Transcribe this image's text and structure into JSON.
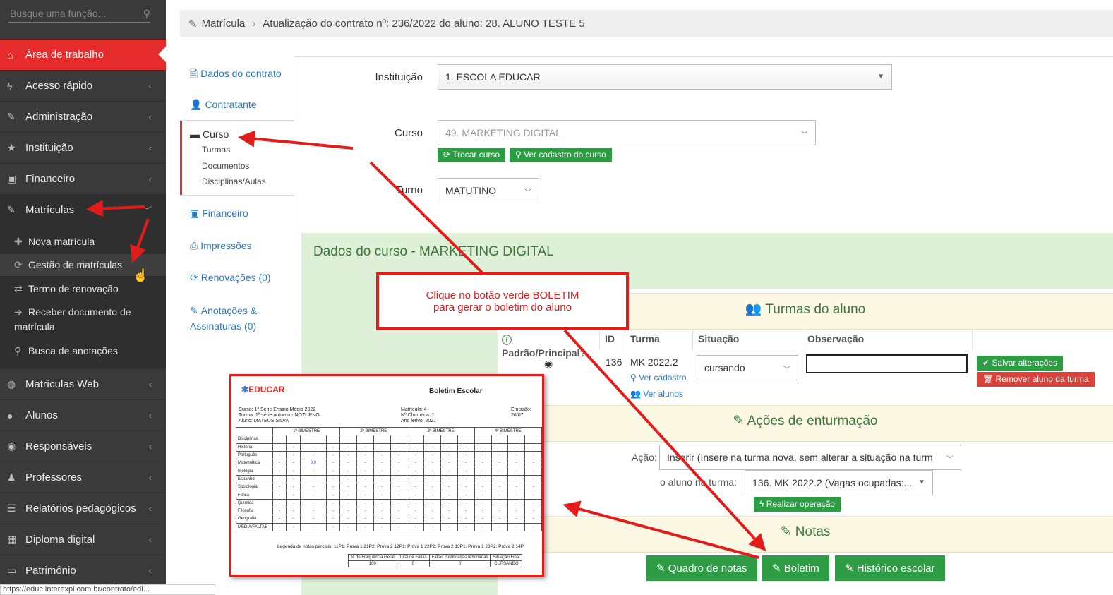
{
  "sidebar": {
    "search_placeholder": "Busque uma função...",
    "items": [
      {
        "label": "Área de trabalho",
        "icon": "home-icon"
      },
      {
        "label": "Acesso rápido",
        "icon": "bolt-icon"
      },
      {
        "label": "Administração",
        "icon": "wrench-icon"
      },
      {
        "label": "Instituição",
        "icon": "star-icon"
      },
      {
        "label": "Financeiro",
        "icon": "money-icon"
      },
      {
        "label": "Matrículas",
        "icon": "edit-icon"
      },
      {
        "label": "Matrículas Web",
        "icon": "globe-icon"
      },
      {
        "label": "Alunos",
        "icon": "user-icon"
      },
      {
        "label": "Responsáveis",
        "icon": "eye-icon"
      },
      {
        "label": "Professores",
        "icon": "teacher-icon"
      },
      {
        "label": "Relatórios pedagógicos",
        "icon": "list-icon"
      },
      {
        "label": "Diploma digital",
        "icon": "qrcode-icon"
      },
      {
        "label": "Patrimônio",
        "icon": "drive-icon"
      }
    ],
    "submenu": [
      {
        "label": "Nova matrícula",
        "icon": "plus-icon"
      },
      {
        "label": "Gestão de matrículas",
        "icon": "refresh-icon"
      },
      {
        "label": "Termo de renovação",
        "icon": "exchange-icon"
      },
      {
        "label": "Receber documento de matrícula",
        "icon": "sign-in-icon"
      },
      {
        "label": "Busca de anotações",
        "icon": "search-icon"
      }
    ]
  },
  "status_url": "https://educ.interexpi.com.br/contrato/edi...",
  "breadcrumb": {
    "root": "Matrícula",
    "current": "Atualização do contrato nº: 236/2022 do aluno: 28. ALUNO TESTE 5"
  },
  "tabs": {
    "dados": "Dados do contrato",
    "contratante": "Contratante",
    "curso": "Curso",
    "turmas": "Turmas",
    "documentos": "Documentos",
    "disciplinas": "Disciplinas/Aulas",
    "financeiro": "Financeiro",
    "impressoes": "Impressões",
    "renovacoes": "Renovações (0)",
    "anotacoes1": "Anotações &",
    "anotacoes2": "Assinaturas (0)"
  },
  "form": {
    "instituicao_label": "Instituição",
    "instituicao_value": "1. ESCOLA EDUCAR",
    "curso_label": "Curso",
    "curso_value": "49. MARKETING DIGITAL",
    "trocar": "Trocar curso",
    "ver_cadastro_curso": "Ver cadastro do curso",
    "turno_label": "Turno",
    "turno_value": "MATUTINO"
  },
  "panel": {
    "title": "Dados do curso - MARKETING DIGITAL",
    "turmas_title": "Turmas do aluno",
    "headers": [
      "Padrão/Principal?",
      "ID",
      "Turma",
      "Situação",
      "Observação"
    ],
    "row": {
      "id": "136",
      "turma": "MK 2022.2",
      "ver_cadastro": "Ver cadastro",
      "ver_alunos": "Ver alunos",
      "situacao": "cursando"
    },
    "salvar": "Salvar alterações",
    "remover": "Remover aluno da turma",
    "acoes_title": "Ações de enturmação",
    "acao_label": "Ação:",
    "acao_value": "Inserir (Insere na turma nova, sem alterar a situação na turm",
    "turma_label": "o aluno na turma:",
    "turma_value": "136. MK 2022.2 (Vagas ocupadas:...",
    "realizar": "Realizar operação",
    "notas_title": "Notas",
    "quadro": "Quadro de notas",
    "boletim": "Boletim",
    "historico": "Histórico escolar"
  },
  "callout": {
    "line1": "Clique no botão verde BOLETIM",
    "line2": "para gerar o boletim do aluno"
  },
  "report": {
    "logo": "EDUCAR",
    "title": "Boletim Escolar",
    "curso": "Curso: 1ª Série Ensino Médio 2022",
    "turma": "Turma: 1ª série noturno - NOTURNO",
    "aluno": "Aluno: MATEUS SILVA",
    "matricula": "Matrícula: 4",
    "chamada": "Nº Chamada: 1",
    "ano": "Ano letivo: 2021",
    "emissao": "Emissão: 26/07",
    "bimestres": [
      "1º BIMESTRE",
      "2º BIMESTRE",
      "3º BIMESTRE",
      "4º BIMESTRE"
    ],
    "disciplinas": [
      "História",
      "Português",
      "Matemática",
      "Biologia",
      "Espanhol",
      "Sociologia",
      "Física",
      "Química",
      "Filosofia",
      "Geografia",
      "MÉDIA/FALTAS"
    ],
    "header_disc": "Disciplinas",
    "nota_mat": "9.0",
    "legenda": "Legenda de notas parciais: 11P1: Prova 1    21P2: Prova 2    12P1: Prova 1    22P2: Prova 2    13P1: Prova 1    23P2: Prova 2    14P",
    "freq_headers": [
      "% de Frequência Geral",
      "Total de Faltas",
      "Faltas Justificadas /Abonadas",
      "Situação Final"
    ],
    "freq_values": [
      "100",
      "0",
      "0",
      "CURSANDO"
    ]
  }
}
